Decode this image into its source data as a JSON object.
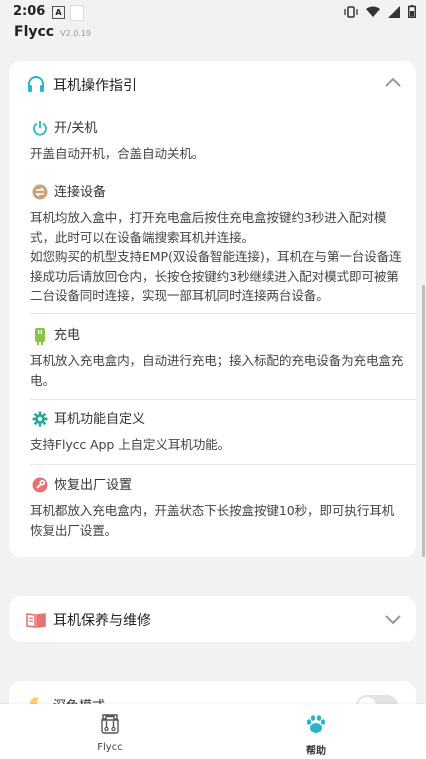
{
  "statusbar": {
    "time": "2:06",
    "notif_letter": "A"
  },
  "app": {
    "name": "Flycc",
    "version": "V2.0.19"
  },
  "card_guide": {
    "title": "耳机操作指引",
    "sections": [
      {
        "title": "开/关机",
        "icon": "power-icon",
        "body": "开盖自动开机，合盖自动关机。"
      },
      {
        "title": "连接设备",
        "icon": "link-icon",
        "body": "耳机均放入盒中，打开充电盒后按住充电盒按键约3秒进入配对模式，此时可以在设备端搜索耳机并连接。",
        "body2": "如您购买的机型支持EMP(双设备智能连接)，耳机在与第一台设备连接成功后请放回仓内，长按仓按键约3秒继续进入配对模式即可被第二台设备同时连接，实现一部耳机同时连接两台设备。"
      },
      {
        "title": "充电",
        "icon": "battery-icon",
        "body": "耳机放入充电盒内，自动进行充电；接入标配的充电设备为充电盒充电。"
      },
      {
        "title": "耳机功能自定义",
        "icon": "gear-icon",
        "body": "支持Flycc App 上自定义耳机功能。"
      },
      {
        "title": "恢复出厂设置",
        "icon": "wrench-icon",
        "body": "耳机都放入充电盒内，开盖状态下长按盒按键10秒，即可执行耳机恢复出厂设置。"
      }
    ]
  },
  "card_maint": {
    "title": "耳机保养与维修"
  },
  "card_dark": {
    "title": "深色模式"
  },
  "nav": {
    "flycc": "Flycc",
    "help": "帮助"
  }
}
